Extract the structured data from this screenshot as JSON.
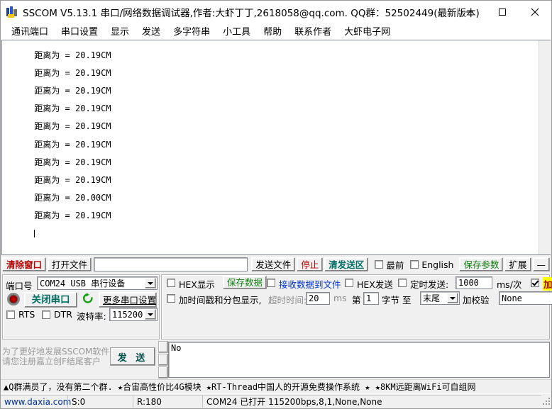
{
  "window": {
    "title": "SSCOM V5.13.1 串口/网络数据调试器,作者:大虾丁丁,2618058@qq.com. QQ群：52502449(最新版本)",
    "icon": "sscom-app-icon",
    "minimize_label": "—",
    "maximize_label": "□",
    "close_label": "✕"
  },
  "menu": {
    "items": [
      {
        "label": "通讯端口",
        "name": "menu-comm-port"
      },
      {
        "label": "串口设置",
        "name": "menu-serial-settings"
      },
      {
        "label": "显示",
        "name": "menu-display"
      },
      {
        "label": "发送",
        "name": "menu-send"
      },
      {
        "label": "多字符串",
        "name": "menu-multi-string"
      },
      {
        "label": "小工具",
        "name": "menu-tools"
      },
      {
        "label": "帮助",
        "name": "menu-help"
      },
      {
        "label": "联系作者",
        "name": "menu-contact-author"
      },
      {
        "label": "大虾电子网",
        "name": "menu-daxia-site"
      }
    ]
  },
  "receive": {
    "lines": [
      "距离为 = 20.19CM",
      "距离为 = 20.19CM",
      "距离为 = 20.19CM",
      "距离为 = 20.19CM",
      "距离为 = 20.19CM",
      "距离为 = 20.19CM",
      "距离为 = 20.19CM",
      "距离为 = 20.19CM",
      "距离为 = 20.00CM",
      "距离为 = 20.19CM"
    ]
  },
  "toolbar": {
    "clear_window": "清除窗口",
    "open_file": "打开文件",
    "file_path_value": "",
    "send_file": "发送文件",
    "stop": "停止",
    "clear_send": "清发送区",
    "topmost_label": "最前",
    "topmost_checked": false,
    "english_label": "English",
    "english_checked": false,
    "save_params": "保存参数",
    "extend": "扩展",
    "collapse": "—"
  },
  "port_panel": {
    "port_label": "端口号",
    "port_value": "COM24 USB 串行设备",
    "close_port_button": "关闭串口",
    "refresh_icon": "refresh-icon",
    "led_icon": "status-led-icon",
    "more_settings": "更多串口设置",
    "rts_label": "RTS",
    "rts_checked": false,
    "dtr_label": "DTR",
    "dtr_checked": false,
    "baud_label": "波特率:",
    "baud_value": "115200"
  },
  "recv_panel": {
    "hex_display_label": "HEX显示",
    "hex_display_checked": false,
    "save_data": "保存数据",
    "recv_to_file_label": "接收数据到文件",
    "recv_to_file_checked": false,
    "hex_send_label": "HEX发送",
    "hex_send_checked": false,
    "timed_send_label": "定时发送:",
    "timed_send_checked": false,
    "timed_send_value": "1000",
    "timed_send_unit": "ms/次",
    "crlf_label": "加回车换行",
    "crlf_checked": true,
    "help_mark": "?",
    "timestamp_label": "加时间戳和分包显示,",
    "timestamp_checked": false,
    "timeout_label": "超时时间:",
    "timeout_value": "20",
    "timeout_unit": "ms",
    "byte_from_label": "第",
    "byte_from_value": "1",
    "byte_mid_label": "字节 至",
    "byte_to_value": "末尾",
    "checksum_label": "加校验",
    "checksum_value": "None"
  },
  "send_panel": {
    "promo_line1": "为了更好地发展SSCOM软件",
    "promo_line2": "请您注册嘉立创F结尾客户",
    "send_button": "发 送",
    "send_text": "No"
  },
  "ad_bar": {
    "text": "▲Q群满员了，没有第二个群. ★合宙高性价比4G模块 ★RT-Thread中国人的开源免费操作系统 ★ ★8KM远距离WiFi可自组网"
  },
  "status_bar": {
    "site": "www.daxia.com",
    "sent": "S:0",
    "received": "R:180",
    "connection": "COM24 已打开  115200bps,8,1,None,None"
  },
  "colors": {
    "accent_red": "#b30000",
    "accent_teal": "#006e63",
    "accent_green": "#107c10",
    "highlight_yellow": "#ffff00",
    "link_blue": "#0033cc"
  }
}
